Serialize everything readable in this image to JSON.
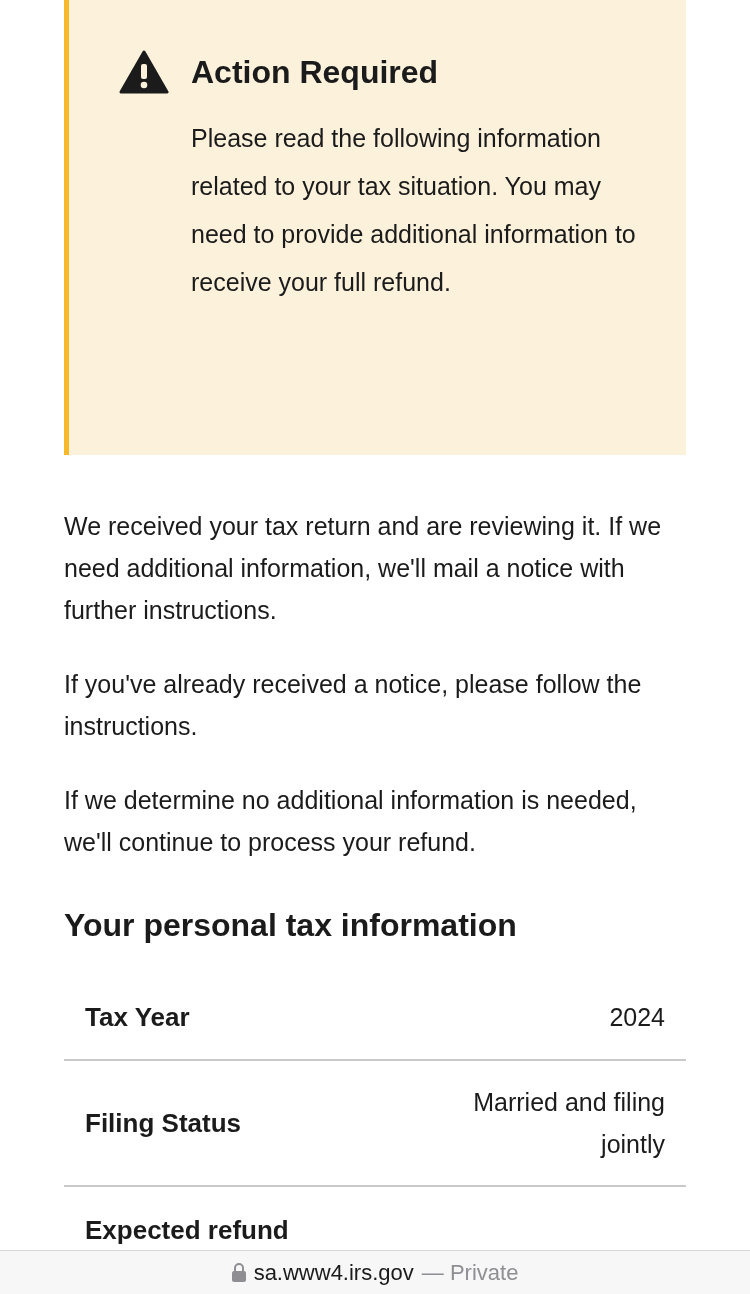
{
  "alert": {
    "title": "Action Required",
    "body": "Please read the following information related to your tax situation. You may need to provide additional information to receive your full refund."
  },
  "paragraphs": [
    "We received your tax return and are reviewing it. If we need additional information, we'll mail a notice with further instructions.",
    "If you've already received a notice, please follow the instructions.",
    "If we determine no additional information is needed, we'll continue to process your refund."
  ],
  "section_title": "Your personal tax information",
  "table": {
    "rows": [
      {
        "label": "Tax Year",
        "value": "2024"
      },
      {
        "label": "Filing Status",
        "value": "Married and filing jointly"
      },
      {
        "label": "Expected refund"
      }
    ]
  },
  "address_bar": {
    "domain": "sa.www4.irs.gov",
    "mode": "— Private"
  }
}
